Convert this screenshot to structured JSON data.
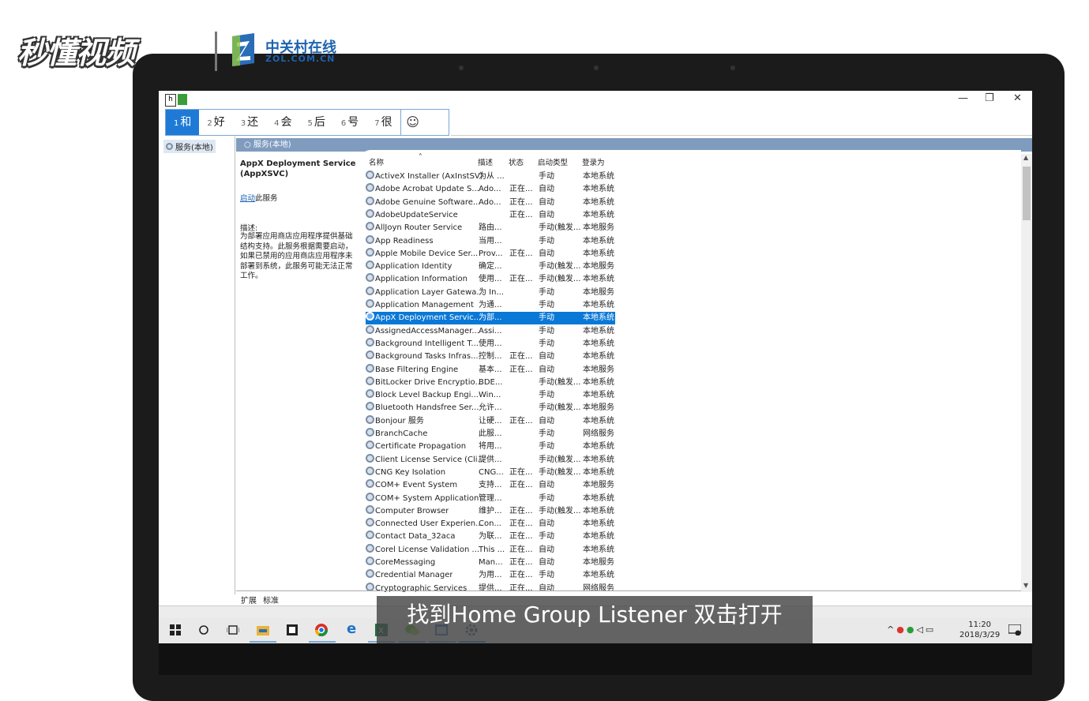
{
  "branding": {
    "logo_text": "秒懂视频",
    "partner_cn": "中关村在线",
    "partner_url": "ZOL.COM.CN"
  },
  "ime": {
    "candidates": [
      {
        "num": "1",
        "char": "和"
      },
      {
        "num": "2",
        "char": "好"
      },
      {
        "num": "3",
        "char": "还"
      },
      {
        "num": "4",
        "char": "会"
      },
      {
        "num": "5",
        "char": "后"
      },
      {
        "num": "6",
        "char": "号"
      },
      {
        "num": "7",
        "char": "很"
      }
    ],
    "emoji": "☺"
  },
  "window": {
    "minimize": "—",
    "restore": "❐",
    "close": "✕"
  },
  "tree": {
    "item": "服务(本地)"
  },
  "panel": {
    "header": "服务(本地)"
  },
  "description": {
    "title": "AppX Deployment Service (AppXSVC)",
    "link_prefix": "启动",
    "link_suffix": "此服务",
    "label": "描述:",
    "text": "为部署应用商店应用程序提供基础结构支持。此服务根据需要启动，如果已禁用的应用商店应用程序未部署到系统，此服务可能无法正常工作。"
  },
  "columns": {
    "name": "名称",
    "desc": "描述",
    "status": "状态",
    "startup": "启动类型",
    "logon": "登录为"
  },
  "services": [
    {
      "name": "ActiveX Installer (AxInstSV)",
      "desc": "为从 ...",
      "status": "",
      "startup": "手动",
      "logon": "本地系统"
    },
    {
      "name": "Adobe Acrobat Update S...",
      "desc": "Ado...",
      "status": "正在...",
      "startup": "自动",
      "logon": "本地系统"
    },
    {
      "name": "Adobe Genuine Software...",
      "desc": "Ado...",
      "status": "正在...",
      "startup": "自动",
      "logon": "本地系统"
    },
    {
      "name": "AdobeUpdateService",
      "desc": "",
      "status": "正在...",
      "startup": "自动",
      "logon": "本地系统"
    },
    {
      "name": "AllJoyn Router Service",
      "desc": "路由...",
      "status": "",
      "startup": "手动(触发...",
      "logon": "本地服务"
    },
    {
      "name": "App Readiness",
      "desc": "当用...",
      "status": "",
      "startup": "手动",
      "logon": "本地系统"
    },
    {
      "name": "Apple Mobile Device Ser...",
      "desc": "Prov...",
      "status": "正在...",
      "startup": "自动",
      "logon": "本地系统"
    },
    {
      "name": "Application Identity",
      "desc": "确定...",
      "status": "",
      "startup": "手动(触发...",
      "logon": "本地服务"
    },
    {
      "name": "Application Information",
      "desc": "使用...",
      "status": "正在...",
      "startup": "手动(触发...",
      "logon": "本地系统"
    },
    {
      "name": "Application Layer Gatewa...",
      "desc": "为 In...",
      "status": "",
      "startup": "手动",
      "logon": "本地服务"
    },
    {
      "name": "Application Management",
      "desc": "为通...",
      "status": "",
      "startup": "手动",
      "logon": "本地系统"
    },
    {
      "name": "AppX Deployment Servic...",
      "desc": "为部...",
      "status": "",
      "startup": "手动",
      "logon": "本地系统",
      "selected": true
    },
    {
      "name": "AssignedAccessManager...",
      "desc": "Assi...",
      "status": "",
      "startup": "手动",
      "logon": "本地系统"
    },
    {
      "name": "Background Intelligent T...",
      "desc": "使用...",
      "status": "",
      "startup": "手动",
      "logon": "本地系统"
    },
    {
      "name": "Background Tasks Infras...",
      "desc": "控制...",
      "status": "正在...",
      "startup": "自动",
      "logon": "本地系统"
    },
    {
      "name": "Base Filtering Engine",
      "desc": "基本...",
      "status": "正在...",
      "startup": "自动",
      "logon": "本地服务"
    },
    {
      "name": "BitLocker Drive Encryptio...",
      "desc": "BDE...",
      "status": "",
      "startup": "手动(触发...",
      "logon": "本地系统"
    },
    {
      "name": "Block Level Backup Engi...",
      "desc": "Win...",
      "status": "",
      "startup": "手动",
      "logon": "本地系统"
    },
    {
      "name": "Bluetooth Handsfree Ser...",
      "desc": "允许...",
      "status": "",
      "startup": "手动(触发...",
      "logon": "本地服务"
    },
    {
      "name": "Bonjour 服务",
      "desc": "让硬...",
      "status": "正在...",
      "startup": "自动",
      "logon": "本地系统"
    },
    {
      "name": "BranchCache",
      "desc": "此服...",
      "status": "",
      "startup": "手动",
      "logon": "网络服务"
    },
    {
      "name": "Certificate Propagation",
      "desc": "将用...",
      "status": "",
      "startup": "手动",
      "logon": "本地系统"
    },
    {
      "name": "Client License Service (Cli...",
      "desc": "提供...",
      "status": "",
      "startup": "手动(触发...",
      "logon": "本地系统"
    },
    {
      "name": "CNG Key Isolation",
      "desc": "CNG...",
      "status": "正在...",
      "startup": "手动(触发...",
      "logon": "本地系统"
    },
    {
      "name": "COM+ Event System",
      "desc": "支持...",
      "status": "正在...",
      "startup": "自动",
      "logon": "本地服务"
    },
    {
      "name": "COM+ System Application",
      "desc": "管理...",
      "status": "",
      "startup": "手动",
      "logon": "本地系统"
    },
    {
      "name": "Computer Browser",
      "desc": "维护...",
      "status": "正在...",
      "startup": "手动(触发...",
      "logon": "本地系统"
    },
    {
      "name": "Connected User Experien...",
      "desc": "Con...",
      "status": "正在...",
      "startup": "自动",
      "logon": "本地系统"
    },
    {
      "name": "Contact Data_32aca",
      "desc": "为联...",
      "status": "正在...",
      "startup": "手动",
      "logon": "本地系统"
    },
    {
      "name": "Corel License Validation ...",
      "desc": "This ...",
      "status": "正在...",
      "startup": "自动",
      "logon": "本地系统"
    },
    {
      "name": "CoreMessaging",
      "desc": "Man...",
      "status": "正在...",
      "startup": "自动",
      "logon": "本地服务"
    },
    {
      "name": "Credential Manager",
      "desc": "为用...",
      "status": "正在...",
      "startup": "手动",
      "logon": "本地系统"
    },
    {
      "name": "Cryptographic Services",
      "desc": "提供...",
      "status": "正在...",
      "startup": "自动",
      "logon": "网络服务"
    }
  ],
  "tabs": {
    "extended": "扩展",
    "standard": "标准"
  },
  "taskbar": {
    "time": "11:20",
    "date": "2018/3/29"
  },
  "subtitle": "找到Home Group Listener 双击打开"
}
